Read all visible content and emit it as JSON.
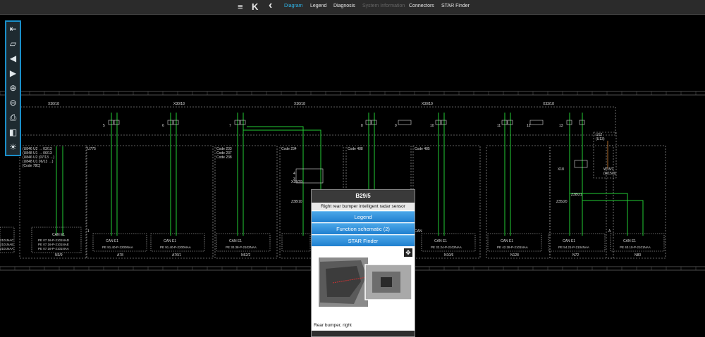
{
  "nav": {
    "menu_icon": "≡",
    "logo_icon": "K",
    "back_icon": "‹",
    "tabs": [
      {
        "label": "Diagram",
        "state": "active"
      },
      {
        "label": "Legend",
        "state": "normal"
      },
      {
        "label": "Diagnosis",
        "state": "normal"
      },
      {
        "label": "System Information",
        "state": "disabled"
      },
      {
        "label": "Connectors",
        "state": "normal"
      },
      {
        "label": "STAR Finder",
        "state": "normal"
      }
    ]
  },
  "toolbar": {
    "icons": [
      "exit-icon",
      "fit-icon",
      "previous-icon",
      "next-icon",
      "zoom-in-icon",
      "zoom-out-icon",
      "print-icon",
      "split-view-icon",
      "brightness-icon"
    ]
  },
  "schematic": {
    "connectors": [
      "X30/18",
      "X30/18",
      "X30/18",
      "X30/19",
      "X33/18"
    ],
    "ecu_labels": [
      "N3/9",
      "A78",
      "A76/1",
      "N62/2",
      "N10/6",
      "N128",
      "N72",
      "N80"
    ],
    "can_label": "CAN E1",
    "part_nums": [
      "PE 91.40-P-2200NAA",
      "PE 91.40-P-2200NAA",
      "PE 30.38-P-2102NAA",
      "PE 32.24-P-2102NAA",
      "PE 42.28-P-2101NAA",
      "PE 54.21-P-2104NAA",
      "PE 40.10-P-2101NAA"
    ],
    "n39_parts": [
      "PE 07.16-P-2101NAD",
      "PE 07.16-P-2101NAE",
      "PE 07.16-P-2101NAA"
    ],
    "code_boxes": [
      "U775",
      "Code 233\nCode 237\nCode 238",
      "Code 234",
      "Code 488",
      "Code 485"
    ],
    "left_codes": [
      "(U846  U2 → 03/13",
      "(U848  U1 → 06/13",
      "(U846  U2 (07/13 →)",
      "(U848  U1  06/13 →)",
      "[Code 78C]"
    ],
    "misc_labels": [
      "X25/29",
      "Z38/10",
      "Z38/21",
      "Z35/20",
      "X18",
      "U12\n(U13)",
      "W15/1\n(W15/0)"
    ],
    "left_edge_text": [
      "2101NAC",
      "2101NAB",
      "2101NAA"
    ],
    "pin_numbers": [
      "5",
      "6",
      "7",
      "8",
      "9",
      "10",
      "11",
      "12",
      "13",
      "4",
      "3",
      "2",
      "1",
      "A",
      "CAN"
    ]
  },
  "popup": {
    "title": "B29/5",
    "subtitle": "Right rear bumper intelligent radar sensor",
    "buttons": [
      "Legend",
      "Function schematic (2)",
      "STAR Finder"
    ],
    "caption": "Rear bumper, right",
    "expand_icon": "expand-icon"
  }
}
